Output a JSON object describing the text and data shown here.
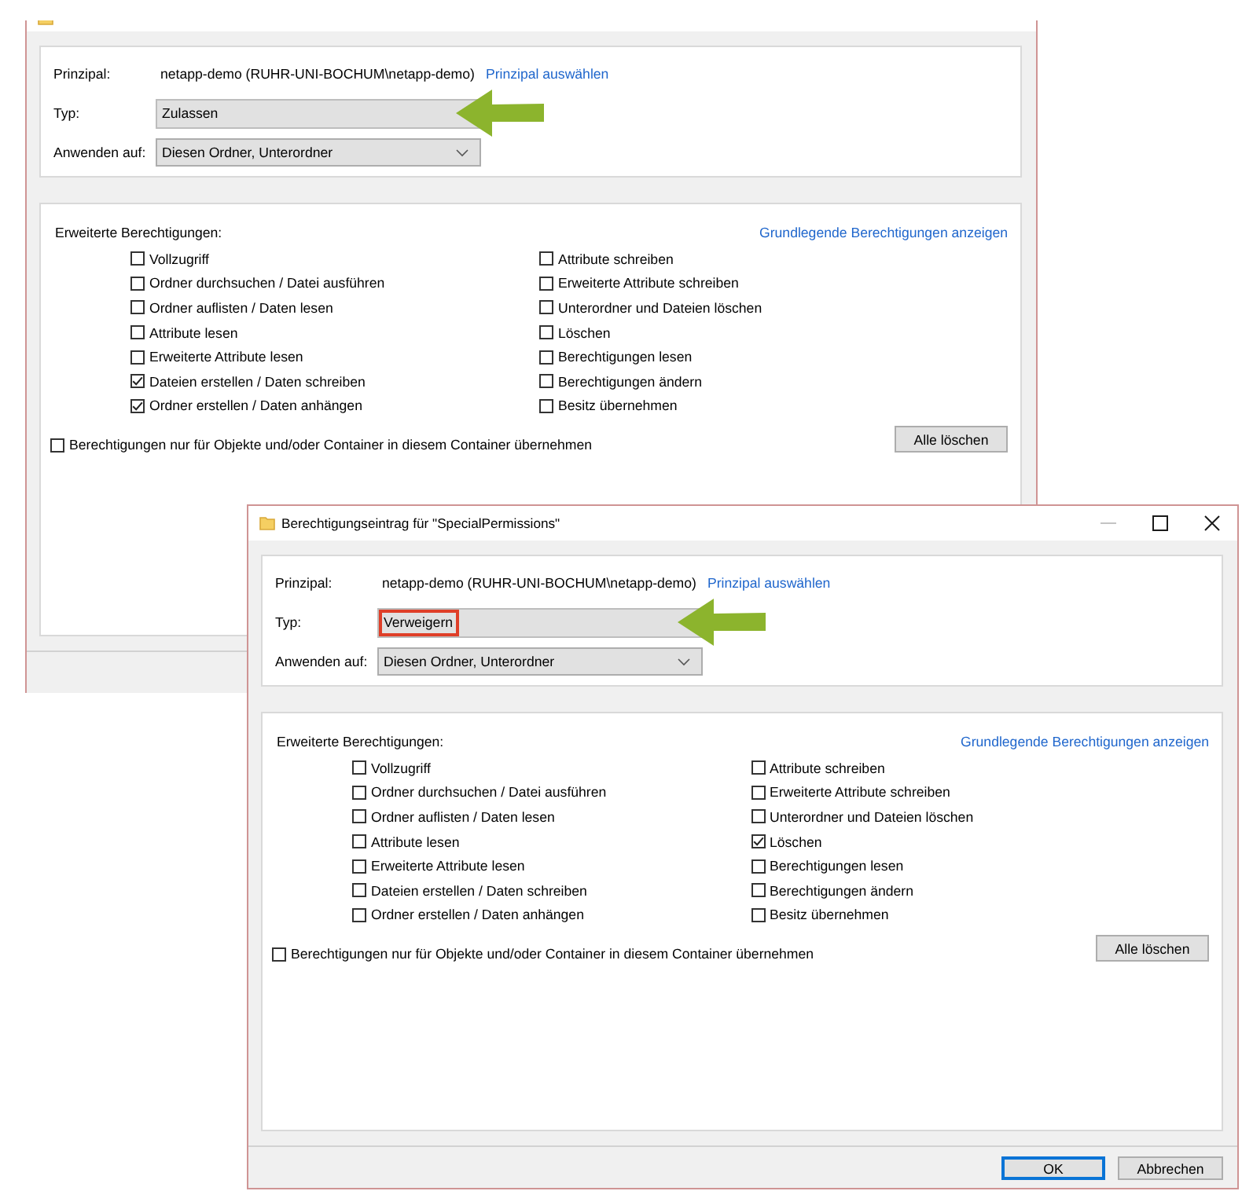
{
  "windows": [
    {
      "principal": {
        "label": "Prinzipal:",
        "value": "netapp-demo (RUHR-UNI-BOCHUM\\netapp-demo)",
        "link": "Prinzipal auswählen"
      },
      "type": {
        "label": "Typ:",
        "value": "Zulassen",
        "highlighted": false,
        "arrow": true
      },
      "apply_to": {
        "label": "Anwenden auf:",
        "value": "Diesen Ordner, Unterordner"
      },
      "permissions": {
        "title": "Erweiterte Berechtigungen:",
        "link": "Grundlegende Berechtigungen anzeigen",
        "left_column": [
          {
            "label": "Vollzugriff",
            "checked": false
          },
          {
            "label": "Ordner durchsuchen / Datei ausführen",
            "checked": false
          },
          {
            "label": "Ordner auflisten / Daten lesen",
            "checked": false
          },
          {
            "label": "Attribute lesen",
            "checked": false
          },
          {
            "label": "Erweiterte Attribute lesen",
            "checked": false
          },
          {
            "label": "Dateien erstellen / Daten schreiben",
            "checked": true
          },
          {
            "label": "Ordner erstellen / Daten anhängen",
            "checked": true
          }
        ],
        "right_column": [
          {
            "label": "Attribute schreiben",
            "checked": false
          },
          {
            "label": "Erweiterte Attribute schreiben",
            "checked": false
          },
          {
            "label": "Unterordner und Dateien löschen",
            "checked": false
          },
          {
            "label": "Löschen",
            "checked": false
          },
          {
            "label": "Berechtigungen lesen",
            "checked": false
          },
          {
            "label": "Berechtigungen ändern",
            "checked": false
          },
          {
            "label": "Besitz übernehmen",
            "checked": false
          }
        ]
      },
      "inherit_only": {
        "label": "Berechtigungen nur für Objekte und/oder Container in diesem Container übernehmen",
        "checked": false
      },
      "clear_button": "Alle löschen"
    },
    {
      "title": "Berechtigungseintrag für \"SpecialPermissions\"",
      "controls": [
        {
          "kind": "minimize",
          "disabled": true
        },
        {
          "kind": "maximize",
          "disabled": false
        },
        {
          "kind": "close",
          "disabled": false
        }
      ],
      "principal": {
        "label": "Prinzipal:",
        "value": "netapp-demo (RUHR-UNI-BOCHUM\\netapp-demo)",
        "link": "Prinzipal auswählen"
      },
      "type": {
        "label": "Typ:",
        "value": "Verweigern",
        "highlighted": true,
        "arrow": true
      },
      "apply_to": {
        "label": "Anwenden auf:",
        "value": "Diesen Ordner, Unterordner"
      },
      "permissions": {
        "title": "Erweiterte Berechtigungen:",
        "link": "Grundlegende Berechtigungen anzeigen",
        "left_column": [
          {
            "label": "Vollzugriff",
            "checked": false
          },
          {
            "label": "Ordner durchsuchen / Datei ausführen",
            "checked": false
          },
          {
            "label": "Ordner auflisten / Daten lesen",
            "checked": false
          },
          {
            "label": "Attribute lesen",
            "checked": false
          },
          {
            "label": "Erweiterte Attribute lesen",
            "checked": false
          },
          {
            "label": "Dateien erstellen / Daten schreiben",
            "checked": false
          },
          {
            "label": "Ordner erstellen / Daten anhängen",
            "checked": false
          }
        ],
        "right_column": [
          {
            "label": "Attribute schreiben",
            "checked": false
          },
          {
            "label": "Erweiterte Attribute schreiben",
            "checked": false
          },
          {
            "label": "Unterordner und Dateien löschen",
            "checked": false
          },
          {
            "label": "Löschen",
            "checked": true
          },
          {
            "label": "Berechtigungen lesen",
            "checked": false
          },
          {
            "label": "Berechtigungen ändern",
            "checked": false
          },
          {
            "label": "Besitz übernehmen",
            "checked": false
          }
        ]
      },
      "inherit_only": {
        "label": "Berechtigungen nur für Objekte und/oder Container in diesem Container übernehmen",
        "checked": false
      },
      "clear_button": "Alle löschen",
      "buttons": [
        {
          "label": "OK",
          "default": true
        },
        {
          "label": "Abbrechen",
          "default": false
        }
      ]
    }
  ]
}
